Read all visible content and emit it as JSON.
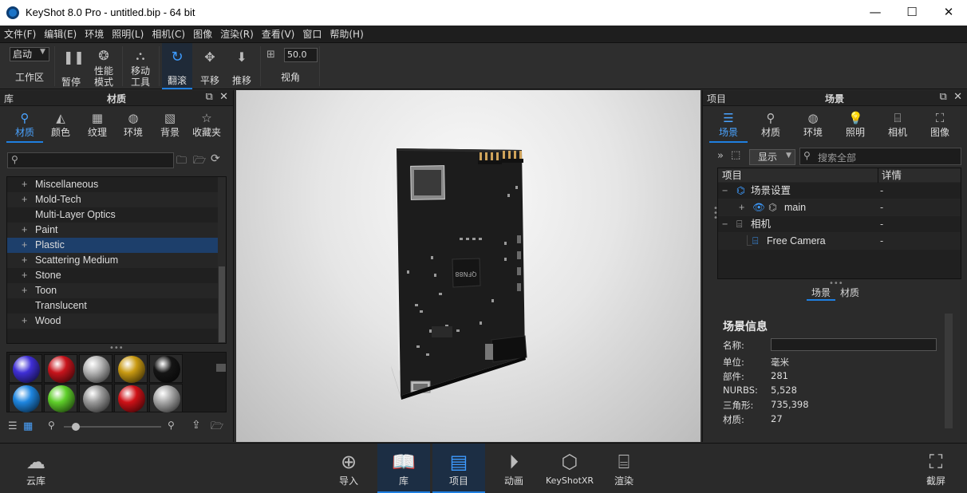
{
  "window": {
    "title": "KeyShot 8.0 Pro  - untitled.bip  - 64 bit",
    "minimize": "—",
    "maximize": "☐",
    "close": "✕"
  },
  "menu": [
    "文件(F)",
    "编辑(E)",
    "环境",
    "照明(L)",
    "相机(C)",
    "图像",
    "渲染(R)",
    "查看(V)",
    "窗口",
    "帮助(H)"
  ],
  "toolbar": {
    "workspace_select": "启动",
    "workspace": "工作区",
    "pause": "暂停",
    "perf1": "性能",
    "perf2": "模式",
    "move1": "移动",
    "move2": "工具",
    "tumble": "翻滚",
    "pan": "平移",
    "dolly": "推移",
    "fov_value": "50.0",
    "fov": "视角"
  },
  "library": {
    "panel_label": "库",
    "title": "材质",
    "tabs": [
      "材质",
      "颜色",
      "纹理",
      "环境",
      "背景",
      "收藏夹"
    ],
    "search_placeholder": "",
    "items": [
      {
        "plus": "+",
        "label": "Miscellaneous"
      },
      {
        "plus": "+",
        "label": "Mold-Tech"
      },
      {
        "plus": "",
        "label": "Multi-Layer Optics"
      },
      {
        "plus": "+",
        "label": "Paint"
      },
      {
        "plus": "+",
        "label": "Plastic"
      },
      {
        "plus": "+",
        "label": "Scattering Medium"
      },
      {
        "plus": "+",
        "label": "Stone"
      },
      {
        "plus": "+",
        "label": "Toon"
      },
      {
        "plus": "",
        "label": "Translucent"
      },
      {
        "plus": "+",
        "label": "Wood"
      }
    ],
    "selected_index": 4,
    "swatches": [
      "#3f2fd6",
      "#c8141c",
      "#b5b5b5",
      "#c99a12",
      "#151515",
      "#1e86e0",
      "#5fcf2a",
      "#9a9a9a",
      "#cf1117",
      "#a8a8a8"
    ]
  },
  "project": {
    "panel_label": "项目",
    "title": "场景",
    "tabs": [
      "场景",
      "材质",
      "环境",
      "照明",
      "相机",
      "图像"
    ],
    "show_select": "显示",
    "search_placeholder": "搜索全部",
    "col_item": "项目",
    "col_details": "详情",
    "tree": [
      {
        "expander": "−",
        "label": "场景设置",
        "value": "-"
      },
      {
        "expander": "+",
        "label": "main",
        "value": "-"
      },
      {
        "expander": "−",
        "label": "相机",
        "value": "-"
      },
      {
        "expander": "",
        "label": "Free Camera",
        "value": "-"
      }
    ],
    "subtabs": [
      "场景",
      "材质"
    ],
    "info": {
      "heading": "场景信息",
      "name_label": "名称:",
      "name_value": "",
      "unit_label": "单位:",
      "unit_value": "毫米",
      "parts_label": "部件:",
      "parts_value": "281",
      "nurbs_label": "NURBS:",
      "nurbs_value": "5,528",
      "tri_label": "三角形:",
      "tri_value": "735,398",
      "mat_label": "材质:",
      "mat_value": "27"
    }
  },
  "pcb": {
    "chip_text": "QFN88"
  },
  "bottombar": {
    "cloud": "云库",
    "import": "导入",
    "library": "库",
    "project": "项目",
    "animation": "动画",
    "keyshotxr": "KeyShotXR",
    "render": "渲染",
    "screenshot": "截屏"
  },
  "colors": {
    "accent": "#1f7fe0",
    "selected_row": "#1d3f6b"
  }
}
